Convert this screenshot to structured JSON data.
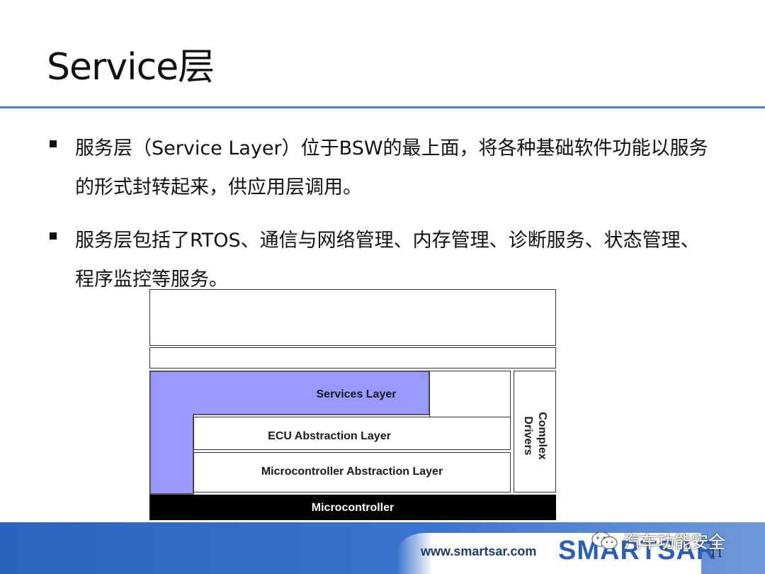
{
  "slide": {
    "title": "Service层",
    "bullets": [
      "服务层（Service Layer）位于BSW的最上面，将各种基础软件功能以服务的形式封转起来，供应用层调用。",
      "服务层包括了RTOS、通信与网络管理、内存管理、诊断服务、状态管理、程序监控等服务。"
    ],
    "page_number": "11"
  },
  "diagram": {
    "services_layer": "Services Layer",
    "ecu_abstraction_layer": "ECU Abstraction Layer",
    "complex_drivers": "Complex Drivers",
    "mcal": "Microcontroller Abstraction Layer",
    "microcontroller": "Microcontroller",
    "services_color": "#9999ff"
  },
  "footer": {
    "url": "www.smartsar.com",
    "brand": "SMARTSAR",
    "channel": "汽车功能安全",
    "bar_color": "#2f68c4"
  }
}
